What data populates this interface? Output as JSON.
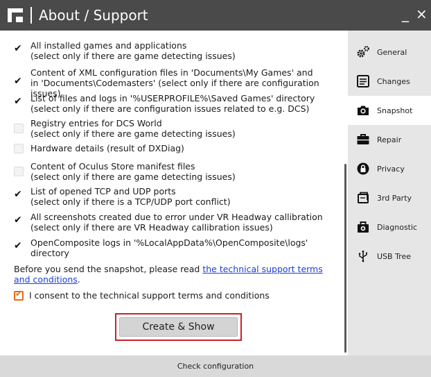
{
  "window": {
    "title": "About / Support",
    "minimize_glyph": "_",
    "close_glyph": "×"
  },
  "options": [
    {
      "checked": true,
      "line1": "All installed games and applications",
      "line2": "(select only if there are game detecting issues)"
    },
    {
      "checked": true,
      "line1": "Content of XML configuration files in 'Documents\\My Games' and",
      "line2": "in 'Documents\\Codemasters' (select only if there are configuration issues)"
    },
    {
      "checked": true,
      "line1": "List of files and logs in '%USERPROFILE%\\Saved Games' directory",
      "line2": "(select only if there are configuration issues related to e.g. DCS)"
    },
    {
      "checked": false,
      "line1": "Registry entries for DCS World",
      "line2": "(select only if there are game detecting issues)"
    },
    {
      "checked": false,
      "line1": "Hardware details (result of DXDiag)",
      "line2": ""
    },
    {
      "checked": false,
      "line1": "Content of Oculus Store manifest files",
      "line2": "(select only if there are game detecting issues)"
    },
    {
      "checked": true,
      "line1": "List of opened TCP and UDP ports",
      "line2": "(select only if there is a TCP/UDP port conflict)"
    },
    {
      "checked": true,
      "line1": "All screenshots created due to error under VR Headway callibration",
      "line2": "(select only if there are VR Headway callibration issues)"
    },
    {
      "checked": true,
      "line1": "OpenComposite logs in '%LocalAppData%\\OpenComposite\\logs' directory",
      "line2": ""
    }
  ],
  "notice": {
    "prefix": "Before you send the snapshot, please read ",
    "link": "the technical support terms and conditions",
    "suffix": "."
  },
  "consent": {
    "label": "I consent to the technical support terms and conditions",
    "checked": true
  },
  "create_button": "Create & Show",
  "sidebar": [
    {
      "label": "General",
      "icon": "gears-icon"
    },
    {
      "label": "Changes",
      "icon": "changes-icon"
    },
    {
      "label": "Snapshot",
      "icon": "camera-icon",
      "active": true
    },
    {
      "label": "Repair",
      "icon": "toolbox-icon"
    },
    {
      "label": "Privacy",
      "icon": "privacy-icon"
    },
    {
      "label": "3rd Party",
      "icon": "third-party-icon"
    },
    {
      "label": "Diagnostic",
      "icon": "diagnostic-icon"
    },
    {
      "label": "USB Tree",
      "icon": "usb-icon"
    }
  ],
  "footer": "Check configuration",
  "colors": {
    "titlebar": "#4a4a4a",
    "sidebar": "#e6e6e6",
    "link": "#1a3fd6",
    "highlight": "#c8202a",
    "consent": "#e86b14"
  }
}
